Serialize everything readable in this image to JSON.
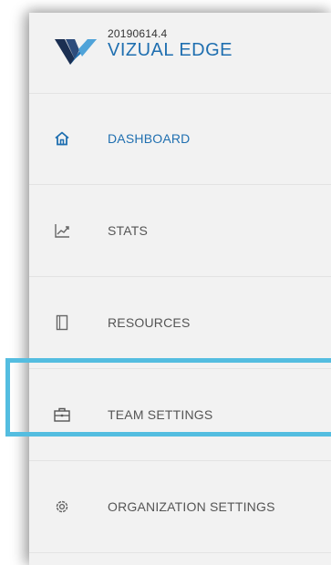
{
  "brand": {
    "version": "20190614.4",
    "name": "VIZUAL EDGE"
  },
  "nav": {
    "items": [
      {
        "label": "DASHBOARD",
        "icon": "home-icon",
        "active": true
      },
      {
        "label": "STATS",
        "icon": "chart-line-icon",
        "active": false
      },
      {
        "label": "RESOURCES",
        "icon": "book-icon",
        "active": false
      },
      {
        "label": "TEAM SETTINGS",
        "icon": "briefcase-icon",
        "active": false,
        "highlighted": true
      },
      {
        "label": "ORGANIZATION SETTINGS",
        "icon": "gear-icon",
        "active": false
      }
    ]
  },
  "colors": {
    "accent": "#1f6fb0",
    "highlight": "#54bde0",
    "panel": "#f2f2f2",
    "text": "#555555"
  }
}
